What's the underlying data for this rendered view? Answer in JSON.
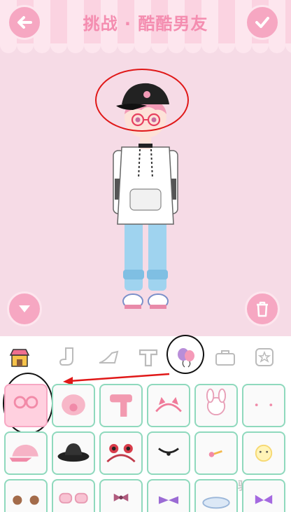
{
  "header": {
    "title": "挑战 · 酷酷男友"
  },
  "watermark": "Bai 经验",
  "tabs": [
    {
      "name": "shop"
    },
    {
      "name": "socks"
    },
    {
      "name": "heels"
    },
    {
      "name": "tops"
    },
    {
      "name": "balloons",
      "selected": true
    },
    {
      "name": "bags"
    },
    {
      "name": "stickers"
    }
  ],
  "items": [
    "pink-glasses",
    "pig-hat",
    "scarf",
    "cat-ears-band",
    "bunny-headpiece",
    "small-hearts",
    "pink-cap",
    "black-hat",
    "frog-headband",
    "choker",
    "hairpin",
    "sun-sticker",
    "bear-ears",
    "pink-sunglasses",
    "bow-necklace",
    "purple-bow",
    "cloud-accessory",
    "purple-ribbon"
  ],
  "colors": {
    "accent": "#f48db0",
    "background": "#f6dbe6",
    "cell_border": "#8fd9bd"
  }
}
